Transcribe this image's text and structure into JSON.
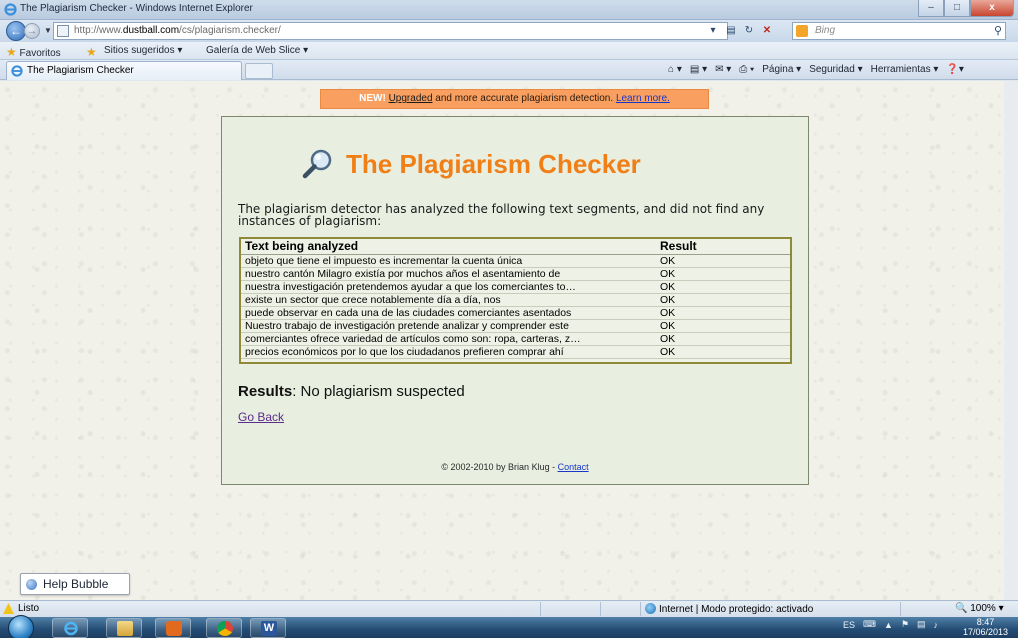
{
  "window": {
    "title": "The Plagiarism Checker - Windows Internet Explorer",
    "minimize": "–",
    "maximize": "□",
    "close": "x"
  },
  "address_bar": {
    "url_prefix": "http://www.",
    "url_domain": "dustball.com",
    "url_path": "/cs/plagiarism.checker/"
  },
  "search": {
    "placeholder": "Bing"
  },
  "favorites_bar": {
    "favorites_label": "Favoritos",
    "items": [
      "Sitios sugeridos ▾",
      "Galería de Web Slice ▾"
    ]
  },
  "tabs": [
    {
      "label": "The Plagiarism Checker"
    }
  ],
  "command_bar": {
    "items": [
      "Página ▾",
      "Seguridad ▾",
      "Herramientas ▾"
    ]
  },
  "banner": {
    "new_label": "NEW!",
    "upgraded_link": "Upgraded",
    "text": " and more accurate plagiarism detection. ",
    "learn_more_link": "Learn more."
  },
  "page": {
    "title": "The Plagiarism Checker",
    "intro": "The plagiarism detector has analyzed the following text segments, and did not find any instances of plagiarism:",
    "table": {
      "headers": [
        "Text being analyzed",
        "Result"
      ],
      "rows": [
        [
          "objeto que tiene el impuesto es incrementar la cuenta única",
          "OK"
        ],
        [
          "nuestro cantón Milagro existía por muchos años el asentamiento de",
          "OK"
        ],
        [
          "nuestra investigación pretendemos ayudar a que los comerciantes to…",
          "OK"
        ],
        [
          "existe un sector que crece notablemente día a día, nos",
          "OK"
        ],
        [
          "puede observar en cada una de las ciudades comerciantes asentados",
          "OK"
        ],
        [
          "Nuestro trabajo de investigación pretende analizar y comprender este",
          "OK"
        ],
        [
          "comerciantes ofrece variedad de artículos como son: ropa, carteras, z…",
          "OK"
        ],
        [
          "precios económicos por lo que los ciudadanos prefieren comprar ahí",
          "OK"
        ]
      ]
    },
    "results_label": "Results",
    "results_value": ": No plagiarism suspected",
    "go_back": "Go Back",
    "footer_text": "© 2002-2010 by Brian Klug - ",
    "footer_contact": "Contact"
  },
  "help_bubble": {
    "label": "Help Bubble"
  },
  "status_bar": {
    "status": "Listo",
    "zone": "Internet | Modo protegido: activado",
    "zoom": " 100%  ▾"
  },
  "taskbar": {
    "language": "ES",
    "time": "8:47",
    "date": "17/06/2013"
  },
  "colors": {
    "accent_title": "#f07f17",
    "banner": "#f9a060",
    "card_bg": "#e8eee0"
  }
}
